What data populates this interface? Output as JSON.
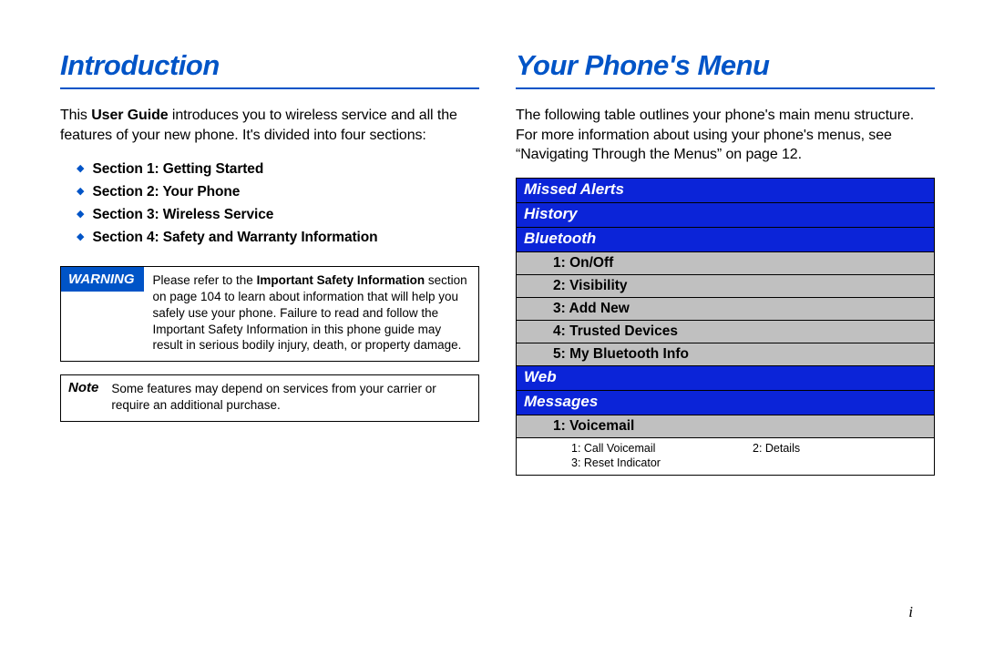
{
  "left": {
    "heading": "Introduction",
    "intro_pre": "This ",
    "intro_bold": "User Guide",
    "intro_post": " introduces you to wireless service and all the features of your new phone. It's divided into four sections:",
    "sections": [
      "Section 1: Getting Started",
      "Section 2: Your Phone",
      "Section 3: Wireless Service",
      "Section 4: Safety and Warranty Information"
    ],
    "warning": {
      "label": "WARNING",
      "body_pre": "Please refer to the ",
      "body_bold": "Important Safety Information",
      "body_post": " section on page 104 to learn about information that will help you safely use your phone. Failure to read and follow the Important Safety Information in this phone guide may result in serious bodily injury, death, or property damage."
    },
    "note": {
      "label": "Note",
      "body": "Some features may depend on services from your carrier or require an additional purchase."
    }
  },
  "right": {
    "heading": "Your Phone's Menu",
    "para": "The following table outlines your phone's main menu structure. For more information about using your phone's menus, see “Navigating Through the Menus” on page 12.",
    "menu": {
      "missed_alerts": "Missed Alerts",
      "history": "History",
      "bluetooth": "Bluetooth",
      "bt_items": [
        "1: On/Off",
        "2: Visibility",
        "3: Add New",
        "4: Trusted Devices",
        "5: My Bluetooth Info"
      ],
      "web": "Web",
      "messages": "Messages",
      "voicemail": "1: Voicemail",
      "voicemail_nested": [
        "1: Call Voicemail",
        "2: Details",
        "3: Reset Indicator"
      ]
    }
  },
  "page_num": "i"
}
